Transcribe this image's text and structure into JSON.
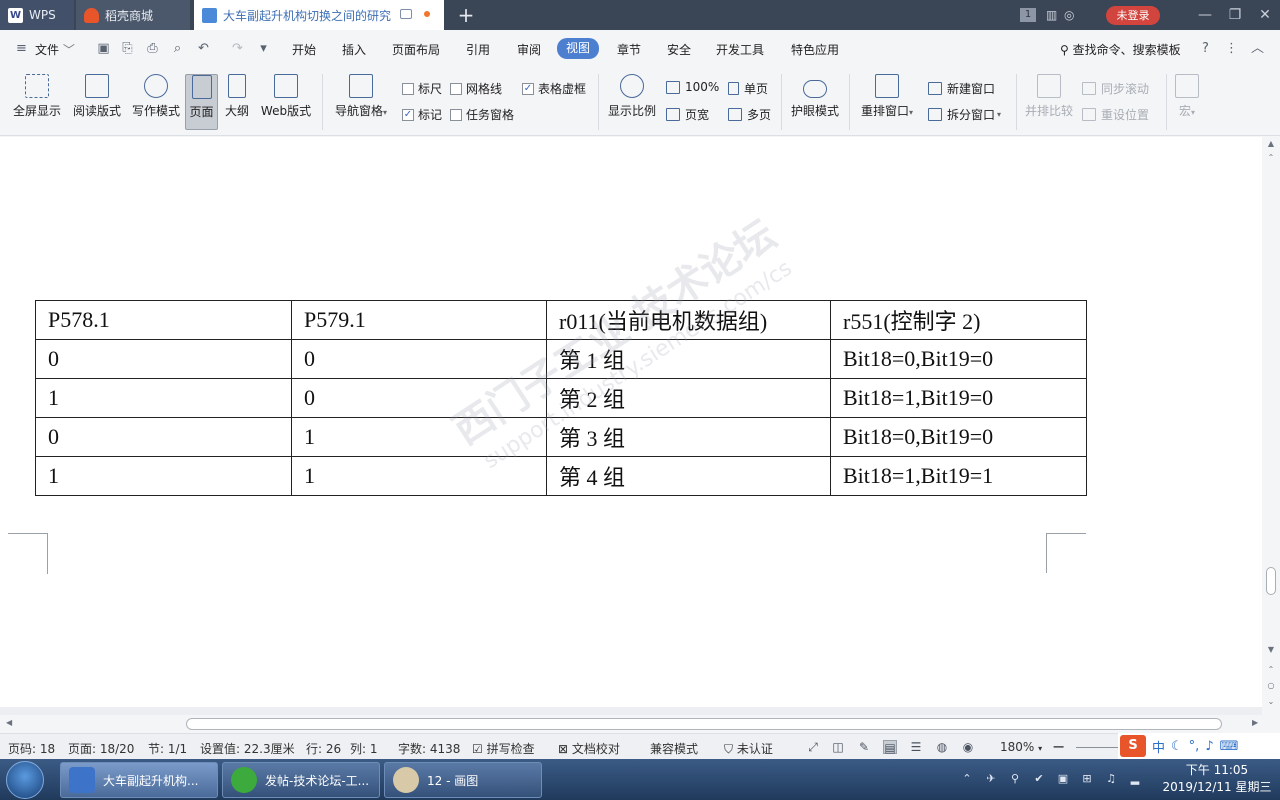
{
  "titlebar": {
    "tabs": [
      {
        "label": "WPS"
      },
      {
        "label": "稻壳商城"
      },
      {
        "label": "大车副起升机构切换之间的研究"
      }
    ],
    "window_count": "1",
    "login_label": "未登录"
  },
  "menubar": {
    "file_label": "文件",
    "items": [
      "开始",
      "插入",
      "页面布局",
      "引用",
      "审阅",
      "视图",
      "章节",
      "安全",
      "开发工具",
      "特色应用"
    ],
    "active_item": "视图",
    "search_label": "查找命令、搜索模板"
  },
  "ribbon": {
    "buttons": [
      "全屏显示",
      "阅读版式",
      "写作模式",
      "页面",
      "大纲",
      "Web版式",
      "导航窗格",
      "显示比例",
      "护眼模式",
      "重排窗口",
      "并排比较",
      "宏"
    ],
    "checkboxes": [
      {
        "label": "标尺",
        "checked": false
      },
      {
        "label": "网格线",
        "checked": false
      },
      {
        "label": "表格虚框",
        "checked": true
      },
      {
        "label": "标记",
        "checked": true
      },
      {
        "label": "任务窗格",
        "checked": false
      }
    ],
    "zoom_100_label": "100%",
    "page_width_label": "页宽",
    "single_page_label": "单页",
    "multi_page_label": "多页",
    "new_window_label": "新建窗口",
    "split_window_label": "拆分窗口",
    "sync_scroll_label": "同步滚动",
    "reset_position_label": "重设位置"
  },
  "document": {
    "table": {
      "rows": [
        [
          "P578.1",
          "P579.1",
          "r011(当前电机数据组)",
          "r551(控制字 2)"
        ],
        [
          "0",
          "0",
          "第 1 组",
          "Bit18=0,Bit19=0"
        ],
        [
          "1",
          "0",
          "第 2 组",
          "Bit18=1,Bit19=0"
        ],
        [
          "0",
          "1",
          "第 3 组",
          "Bit18=0,Bit19=0"
        ],
        [
          "1",
          "1",
          "第 4 组",
          "Bit18=1,Bit19=1"
        ]
      ]
    },
    "watermark": {
      "line1": "西门子工业 技术论坛",
      "line2": "support.industry.siemens.com/cs"
    }
  },
  "statusbar": {
    "page_code": "页码: 18",
    "page": "页面: 18/20",
    "section": "节: 1/1",
    "setting": "设置值: 22.3厘米",
    "row": "行: 26",
    "col": "列: 1",
    "word_count": "字数: 4138",
    "spell_check": "拼写检查",
    "doc_proof": "文档校对",
    "compat_mode": "兼容模式",
    "unverified": "未认证",
    "zoom": "180%"
  },
  "ime": {
    "label": "中"
  },
  "taskbar": {
    "tasks": [
      {
        "label": "大车副起升机构..."
      },
      {
        "label": "发帖-技术论坛-工..."
      },
      {
        "label": "12 - 画图"
      }
    ],
    "time": "下午 11:05",
    "date": "2019/12/11 星期三"
  },
  "colors": {
    "accent": "#4d7fd1",
    "titlebar": "#3a4556",
    "login_badge": "#d2453e",
    "taskbar": "#2c4a72"
  }
}
